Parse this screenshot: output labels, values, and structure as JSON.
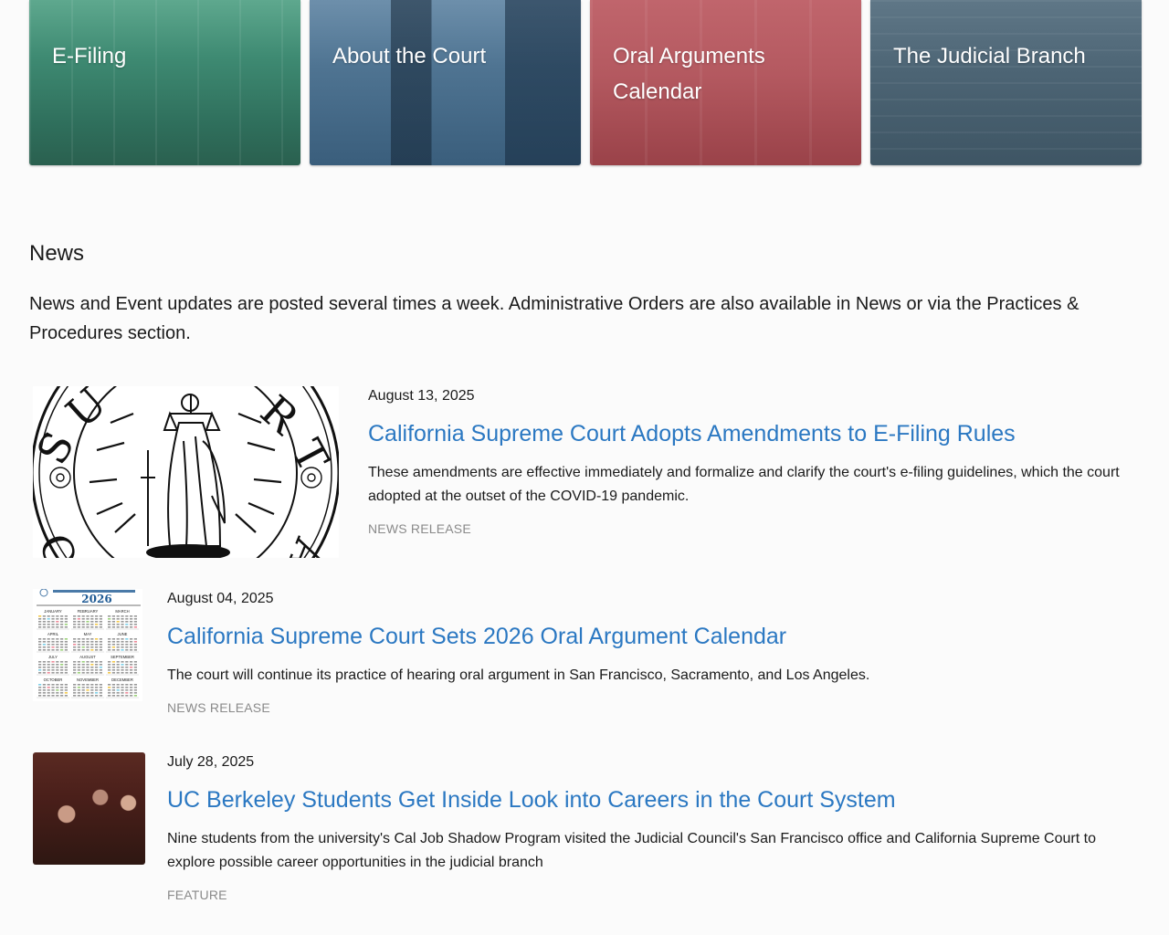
{
  "cards": [
    {
      "label": "E-Filing"
    },
    {
      "label": "About the Court"
    },
    {
      "label": "Oral Arguments Calendar"
    },
    {
      "label": "The Judicial Branch"
    }
  ],
  "news": {
    "heading": "News",
    "intro": "News and Event updates are posted several times a week. Administrative Orders are also available in News or via the Practices & Procedures section.",
    "items": [
      {
        "date": "August 13, 2025",
        "title": "California Supreme Court Adopts Amendments to E-Filing Rules",
        "summary": "These amendments are effective immediately and formalize and clarify the court's e-filing guidelines, which the court adopted at the outset of the COVID-19 pandemic.",
        "tag": "NEWS RELEASE",
        "seal_letters_top": "SUPREME COURT",
        "seal_letters_bottom": "OF CALIFORNIA"
      },
      {
        "date": "August 04, 2025",
        "title": "California Supreme Court Sets 2026 Oral Argument Calendar",
        "summary": "The court will continue its practice of hearing oral argument in San Francisco, Sacramento, and Los Angeles.",
        "tag": "NEWS RELEASE",
        "calendar_year": "2026",
        "calendar_months": [
          "JANUARY",
          "FEBRUARY",
          "MARCH",
          "APRIL",
          "MAY",
          "JUNE",
          "JULY",
          "AUGUST",
          "SEPTEMBER",
          "OCTOBER",
          "NOVEMBER",
          "DECEMBER"
        ]
      },
      {
        "date": "July 28, 2025",
        "title": "UC Berkeley Students Get Inside Look into Careers in the Court System",
        "summary": "Nine students from the university's Cal Job Shadow Program visited the Judicial Council's San Francisco office and California Supreme Court to explore possible career opportunities in the judicial branch",
        "tag": "FEATURE"
      }
    ]
  },
  "colors": {
    "link": "#2b78c2",
    "tag": "#8a8a8a",
    "text": "#1a1a1a"
  }
}
